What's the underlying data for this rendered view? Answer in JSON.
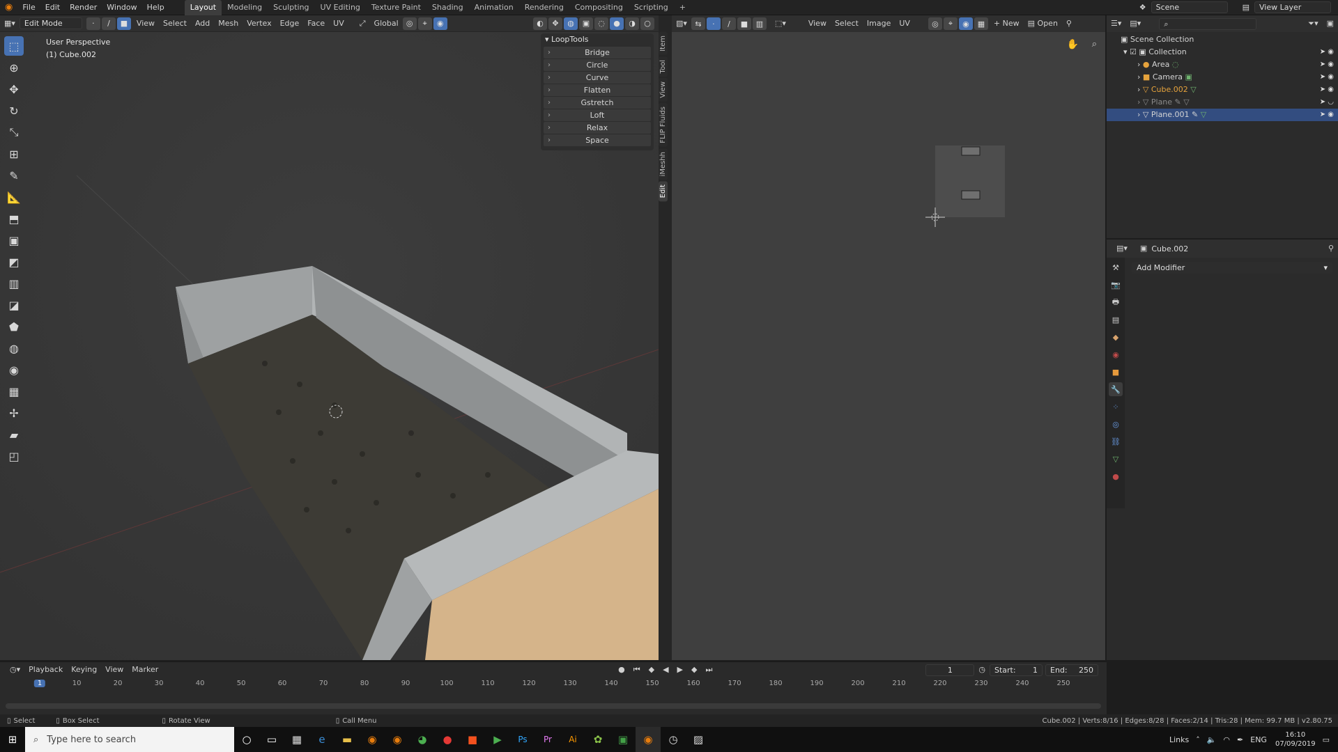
{
  "topbar": {
    "menus": [
      "File",
      "Edit",
      "Render",
      "Window",
      "Help"
    ],
    "workspaces": [
      "Layout",
      "Modeling",
      "Sculpting",
      "UV Editing",
      "Texture Paint",
      "Shading",
      "Animation",
      "Rendering",
      "Compositing",
      "Scripting"
    ],
    "active_workspace": "Layout",
    "add_tab": "+",
    "scene": "Scene",
    "view_layer": "View Layer"
  },
  "viewport": {
    "mode": "Edit Mode",
    "menus": [
      "View",
      "Select",
      "Add",
      "Mesh",
      "Vertex",
      "Edge",
      "Face",
      "UV"
    ],
    "transform_orientation": "Global",
    "perspective_label": "User Perspective",
    "object_label": "(1) Cube.002"
  },
  "looptools": {
    "title": "LoopTools",
    "items": [
      "Bridge",
      "Circle",
      "Curve",
      "Flatten",
      "Gstretch",
      "Loft",
      "Relax",
      "Space"
    ]
  },
  "side_tabs": [
    "Item",
    "Tool",
    "View",
    "FLIP Fluids",
    "iMeshh",
    "Edit"
  ],
  "uv_editor": {
    "menus": [
      "View",
      "Select",
      "Image",
      "UV"
    ],
    "new_label": "New",
    "open_label": "Open"
  },
  "outliner": {
    "scene_collection": "Scene Collection",
    "collection": "Collection",
    "items": [
      {
        "name": "Area"
      },
      {
        "name": "Camera"
      },
      {
        "name": "Cube.002"
      },
      {
        "name": "Plane"
      },
      {
        "name": "Plane.001"
      }
    ]
  },
  "properties": {
    "object_name": "Cube.002",
    "add_modifier": "Add Modifier"
  },
  "timeline": {
    "menus": [
      "Playback",
      "Keying",
      "View",
      "Marker"
    ],
    "current_frame": "1",
    "start_label": "Start:",
    "start_value": "1",
    "end_label": "End:",
    "end_value": "250",
    "ticks": [
      "1",
      "10",
      "20",
      "30",
      "40",
      "50",
      "60",
      "70",
      "80",
      "90",
      "100",
      "110",
      "120",
      "130",
      "140",
      "150",
      "160",
      "170",
      "180",
      "190",
      "200",
      "210",
      "220",
      "230",
      "240",
      "250"
    ]
  },
  "status": {
    "select": "Select",
    "box_select": "Box Select",
    "rotate_view": "Rotate View",
    "call_menu": "Call Menu",
    "stats": "Cube.002 | Verts:8/16 | Edges:8/28 | Faces:2/14 | Tris:28 | Mem: 99.7 MB | v2.80.75"
  },
  "taskbar": {
    "search_placeholder": "Type here to search",
    "links": "Links",
    "lang": "ENG",
    "time": "16:10",
    "date": "07/09/2019"
  },
  "colors": {
    "accent": "#4772b3",
    "active_object": "#e6a33c",
    "selected_row": "#334d80"
  }
}
